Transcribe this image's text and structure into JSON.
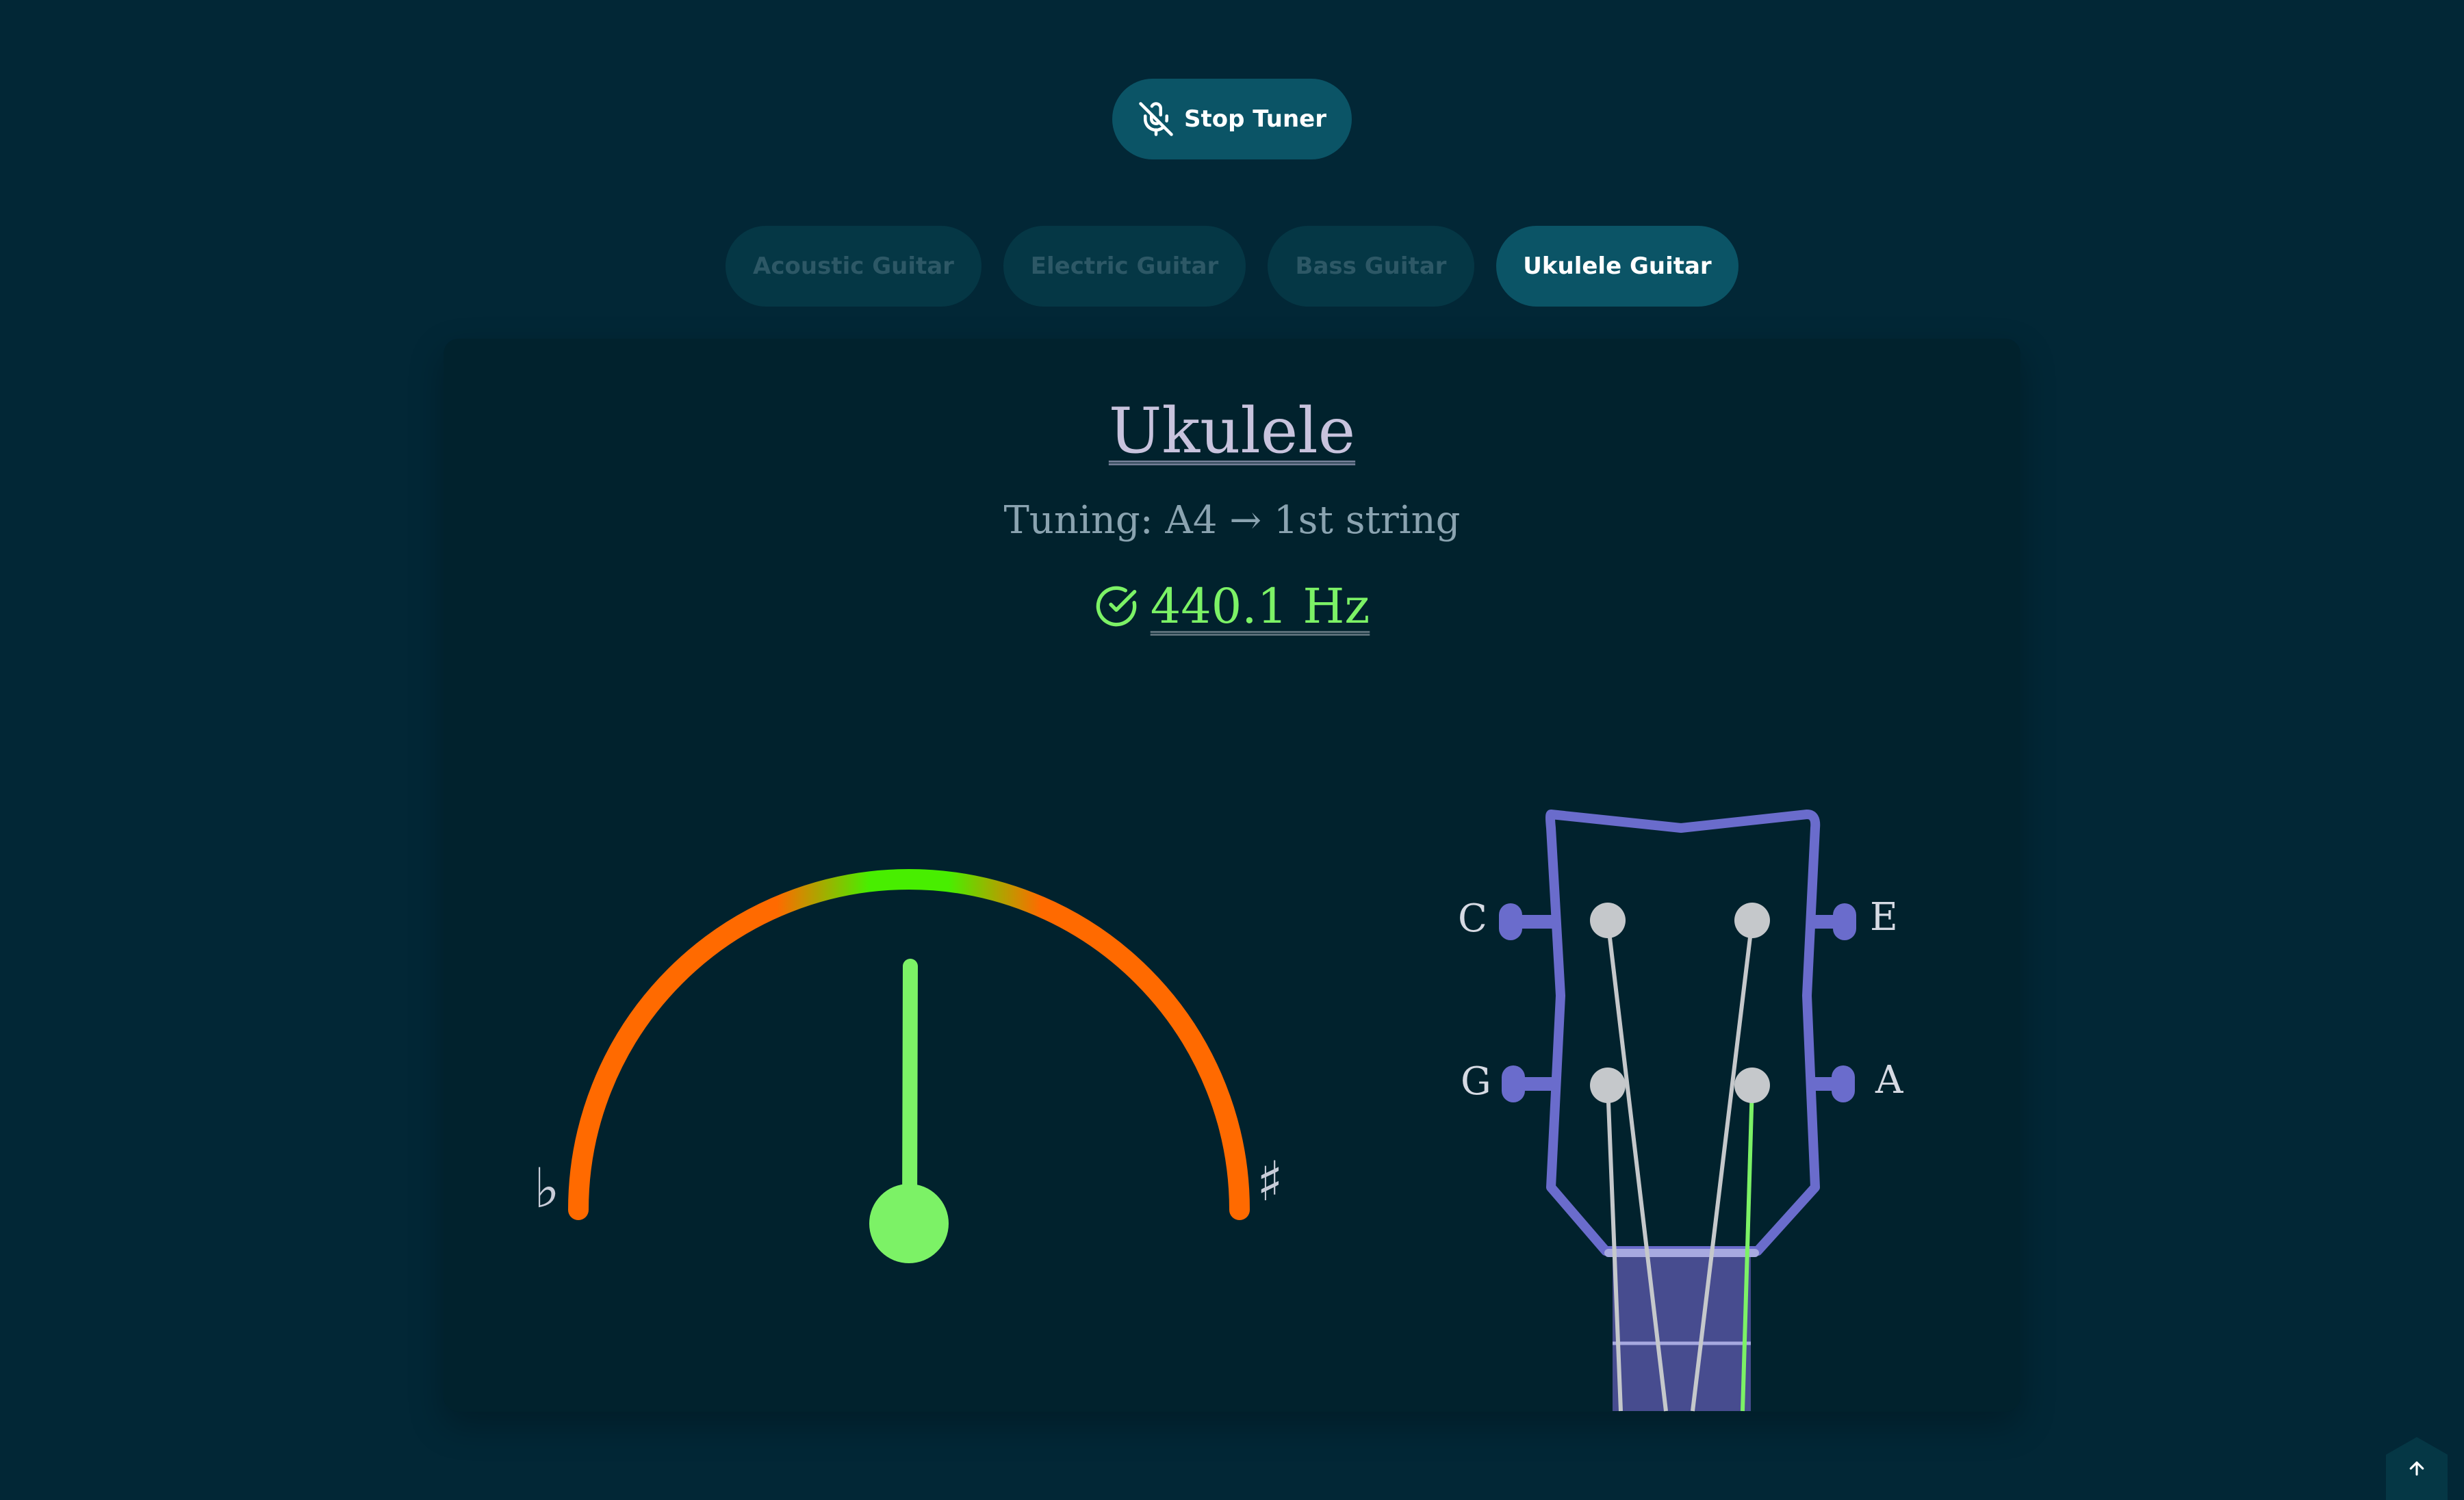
{
  "stop_button": {
    "label": "Stop Tuner",
    "icon": "mic-off-icon"
  },
  "instrument_tabs": [
    {
      "label": "Acoustic Guitar",
      "active": false
    },
    {
      "label": "Electric Guitar",
      "active": false
    },
    {
      "label": "Bass Guitar",
      "active": false
    },
    {
      "label": "Ukulele Guitar",
      "active": true
    }
  ],
  "tuner": {
    "instrument_title": "Ukulele",
    "tuning_text": "Tuning: A4 → 1st string",
    "frequency": "440.1 Hz",
    "status_icon": "check-circle-icon",
    "status": "in-tune",
    "flat_symbol": "♭",
    "sharp_symbol": "♯"
  },
  "strings": {
    "left_top": "C",
    "left_bottom": "G",
    "right_top": "E",
    "right_bottom": "A",
    "active_string": "A"
  },
  "colors": {
    "background": "#022736",
    "card": "#01222d",
    "accent": "#0b5466",
    "in_tune": "#7cf266",
    "gauge_off": "#ff6a00",
    "gauge_center": "#44ee00",
    "headstock": "#6a6ccc",
    "fretboard": "#474c8f"
  }
}
